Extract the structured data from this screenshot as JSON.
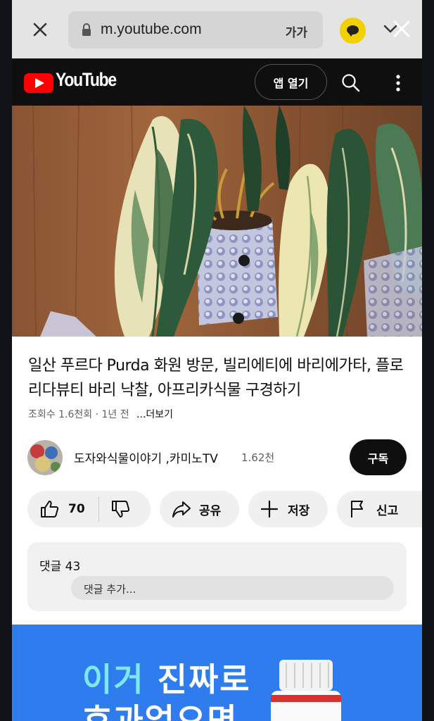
{
  "browser": {
    "url": "m.youtube.com",
    "text_size_label": "가가"
  },
  "youtube": {
    "wordmark": "YouTube",
    "open_app_label": "앱 열기"
  },
  "video": {
    "title": "일산 푸르다 Purda 화원 방문, 빌리에티에 바리에가타, 플로리다뷰티 바리 낙찰, 아프리카식물 구경하기",
    "views": "조회수 1.6천회",
    "age": "1년 전",
    "more_label": "...더보기"
  },
  "channel": {
    "name": "도자와식물이야기 ,카미노TV",
    "subscribers": "1.62천",
    "subscribe_label": "구독"
  },
  "actions": {
    "like_count": "70",
    "share_label": "공유",
    "save_label": "저장",
    "report_label": "신고"
  },
  "comments": {
    "title": "댓글 43",
    "placeholder": "댓글 추가..."
  },
  "ad": {
    "highlight": "이거",
    "line1_rest": "진짜로",
    "line2": "효과없으면"
  },
  "colors": {
    "youtube_red": "#ff0000",
    "ad_blue": "#2e7cee",
    "kakao_yellow": "#f3d000"
  }
}
